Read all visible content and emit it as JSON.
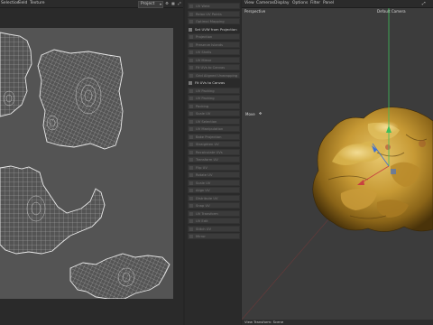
{
  "uv_editor": {
    "menu": [
      "Selection",
      "Field",
      "Texture"
    ],
    "projection_dropdown": "Project"
  },
  "tool_panel": {
    "items": [
      {
        "label": "UV Weld",
        "active": false
      },
      {
        "label": "Relax UV Points",
        "active": false
      },
      {
        "label": "Optimal Mapping",
        "active": false
      },
      {
        "label": "Set UVW from Projection",
        "active": true,
        "header": true
      },
      {
        "label": "Projection",
        "active": false
      },
      {
        "label": "Preserve Islands",
        "active": false
      },
      {
        "label": "UV Shells",
        "active": false
      },
      {
        "label": "UV Mirror",
        "active": false
      },
      {
        "label": "Fit UVs to Canvas",
        "active": false
      },
      {
        "label": "Grid Aligned Unwrapping",
        "active": false
      },
      {
        "label": "Fit UVs to Canvas",
        "active": true,
        "header": true
      },
      {
        "label": "UV Packing",
        "active": false
      },
      {
        "label": "UV Packing",
        "active": false
      },
      {
        "label": "Packing",
        "active": false
      },
      {
        "label": "Scale UV",
        "active": false
      },
      {
        "label": "UV Selection",
        "active": false
      },
      {
        "label": "UV Manipulation",
        "active": false
      },
      {
        "label": "Bake Projection",
        "active": false
      },
      {
        "label": "Straighten UV",
        "active": false
      },
      {
        "label": "Recalculate UVs",
        "active": false
      },
      {
        "label": "Transform UV",
        "active": false
      },
      {
        "label": "Flip UV",
        "active": false
      },
      {
        "label": "Rotate UV",
        "active": false
      },
      {
        "label": "Scale UV",
        "active": false
      },
      {
        "label": "Align UV",
        "active": false
      },
      {
        "label": "Distribute UV",
        "active": false
      },
      {
        "label": "Snap UV",
        "active": false
      },
      {
        "label": "UV Transform",
        "active": false
      },
      {
        "label": "UV Edit",
        "active": false
      },
      {
        "label": "Stitch UV",
        "active": false
      },
      {
        "label": "Mirror",
        "active": false
      }
    ]
  },
  "viewport": {
    "menu": [
      "View",
      "Cameras",
      "Display",
      "Options",
      "Filter",
      "Panel"
    ],
    "view_name": "Perspective",
    "camera_name": "Default Camera",
    "tool_label": "Move",
    "status": "View Transform: Scene"
  },
  "colors": {
    "uv_background": "#545454",
    "uv_wire": "#d8d8d8",
    "viewport_bg": "#3c3c3c",
    "axis_y": "#3fbf5a",
    "axis_x": "#c84040",
    "axis_z": "#3a6fd8",
    "model_yellow": "#c79a35",
    "model_shadow": "#5a3f10"
  }
}
